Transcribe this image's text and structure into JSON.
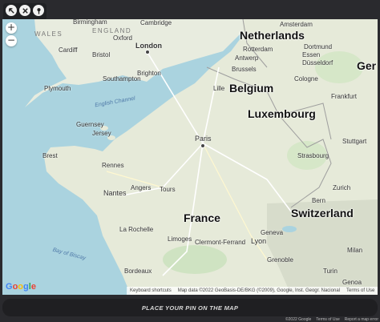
{
  "toolbar": {
    "icons": [
      "arrow-icon",
      "crossed-arrows-icon",
      "pin-icon"
    ]
  },
  "map": {
    "zoom_in": "+",
    "zoom_out": "−",
    "countries": {
      "netherlands": "Netherlands",
      "belgium": "Belgium",
      "luxembourg": "Luxembourg",
      "germany_partial": "Ger",
      "france": "France",
      "switzerland": "Switzerland"
    },
    "regions": {
      "wales": "WALES",
      "england": "ENGLAND"
    },
    "seas": {
      "english_channel": "English Channel",
      "bay_of_biscay": "Bay of Biscay"
    },
    "cities": {
      "birmingham": "Birmingham",
      "cambridge": "Cambridge",
      "oxford": "Oxford",
      "cardiff": "Cardiff",
      "london": "London",
      "bristol": "Bristol",
      "southampton": "Southampton",
      "brighton": "Brighton",
      "plymouth": "Plymouth",
      "guernsey": "Guernsey",
      "jersey": "Jersey",
      "brest": "Brest",
      "rennes": "Rennes",
      "nantes": "Nantes",
      "angers": "Angers",
      "tours": "Tours",
      "paris": "Paris",
      "lille": "Lille",
      "amsterdam": "Amsterdam",
      "rotterdam": "Rotterdam",
      "antwerp": "Antwerp",
      "brussels": "Brussels",
      "dortmund": "Dortmund",
      "essen": "Essen",
      "dusseldorf": "Düsseldorf",
      "cologne": "Cologne",
      "frankfurt": "Frankfurt",
      "stuttgart": "Stuttgart",
      "strasbourg": "Strasbourg",
      "zurich": "Zurich",
      "bern": "Bern",
      "la_rochelle": "La Rochelle",
      "limoges": "Limoges",
      "clermont_ferrand": "Clermont-Ferrand",
      "lyon": "Lyon",
      "geneva": "Geneva",
      "grenoble": "Grenoble",
      "bordeaux": "Bordeaux",
      "milan": "Milan",
      "turin": "Turin",
      "genoa": "Genoa"
    },
    "attribution": {
      "shortcuts": "Keyboard shortcuts",
      "data": "Map data ©2022 GeoBasis-DE/BKG (©2009), Google, Inst. Geogr. Nacional",
      "terms": "Terms of Use"
    },
    "google_logo": [
      "G",
      "o",
      "o",
      "g",
      "l",
      "e"
    ]
  },
  "action_bar": {
    "label": "PLACE YOUR PIN ON THE MAP"
  },
  "footer": {
    "copyright": "©2022 Google",
    "terms": "Terms of Use",
    "report": "Report a map error"
  }
}
